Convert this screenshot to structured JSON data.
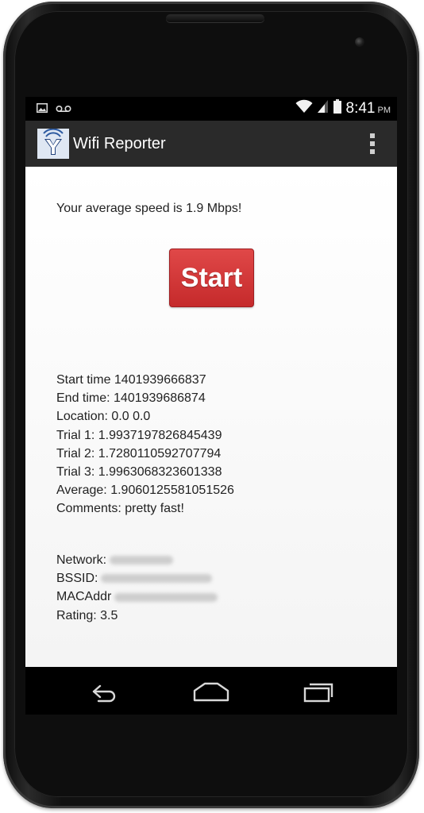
{
  "status_bar": {
    "time": "8:41",
    "ampm": "PM",
    "icons": [
      "gallery-icon",
      "voicemail-icon",
      "wifi-icon",
      "signal-icon",
      "battery-icon"
    ]
  },
  "action_bar": {
    "title": "Wifi Reporter",
    "app_icon": "y-logo-icon",
    "menu_icon": "overflow-menu-icon"
  },
  "main": {
    "average_speed_text": "Your average speed is 1.9 Mbps!",
    "start_label": "Start",
    "start_color": "#d33535",
    "info": [
      "Start time 1401939666837",
      "End time: 1401939686874",
      "Location: 0.0 0.0",
      "Trial 1: 1.9937197826845439",
      "Trial 2: 1.7280110592707794",
      "Trial 3: 1.9963068323601338",
      "Average: 1.9060125581051526",
      "Comments: pretty fast!"
    ],
    "network": {
      "network_label": "Network:",
      "bssid_label": "BSSID:",
      "mac_label": "MACAddr",
      "rating": "Rating: 3.5"
    }
  },
  "nav_bar": {
    "icons": [
      "back-icon",
      "home-icon",
      "recent-apps-icon"
    ]
  }
}
